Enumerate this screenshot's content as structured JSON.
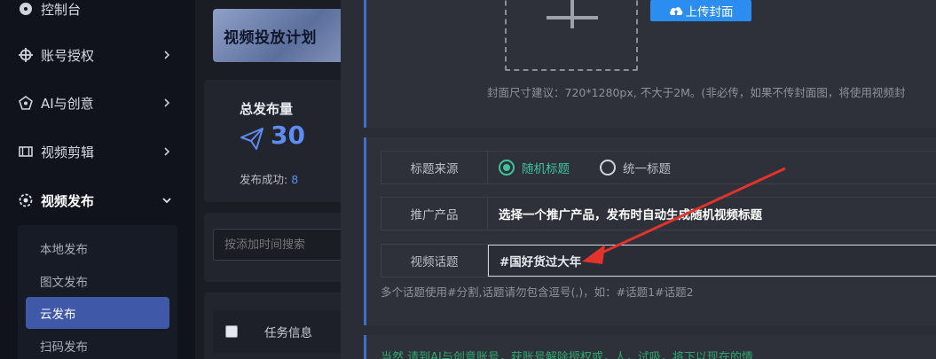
{
  "sidebar": {
    "items": [
      {
        "label": "控制台",
        "icon": "dashboard-icon"
      },
      {
        "label": "账号授权",
        "icon": "crosshair-icon"
      },
      {
        "label": "AI与创意",
        "icon": "ai-icon"
      },
      {
        "label": "视频剪辑",
        "icon": "film-icon"
      },
      {
        "label": "视频发布",
        "icon": "publish-icon"
      }
    ],
    "submenu": [
      {
        "label": "本地发布"
      },
      {
        "label": "图文发布"
      },
      {
        "label": "云发布"
      },
      {
        "label": "扫码发布"
      }
    ]
  },
  "middle": {
    "banner_title": "视频投放计划",
    "stats": {
      "label": "总发布量",
      "count": "30",
      "success_label": "发布成功:",
      "success_count": "8"
    },
    "search_placeholder": "按添加时间搜索",
    "table_header": "任务信息"
  },
  "modal": {
    "upload_button": "上传封面",
    "cover_hint": "封面尺寸建议：720*1280px, 不大于2M。(非必传，如果不传封面图，将使用视频封",
    "title_source_label": "标题来源",
    "radio_random": "随机标题",
    "radio_unified": "统一标题",
    "product_label": "推广产品",
    "product_value": "选择一个推广产品，发布时自动生成随机视频标题",
    "topic_label": "视频话题",
    "topic_value": "#国好货过大年",
    "topic_hint": "多个话题使用#分割,话题请勿包含逗号(,)，如：#话题1#话题2",
    "bottom_text": "当然 请到AI与创意账号，获账号解除授权或，人，试吸，将下以现在的情"
  },
  "colors": {
    "accent_blue": "#2b8df0",
    "active_menu": "#3f58a8",
    "radio_green": "#3ec39a",
    "annotation_red": "#e0332b"
  }
}
